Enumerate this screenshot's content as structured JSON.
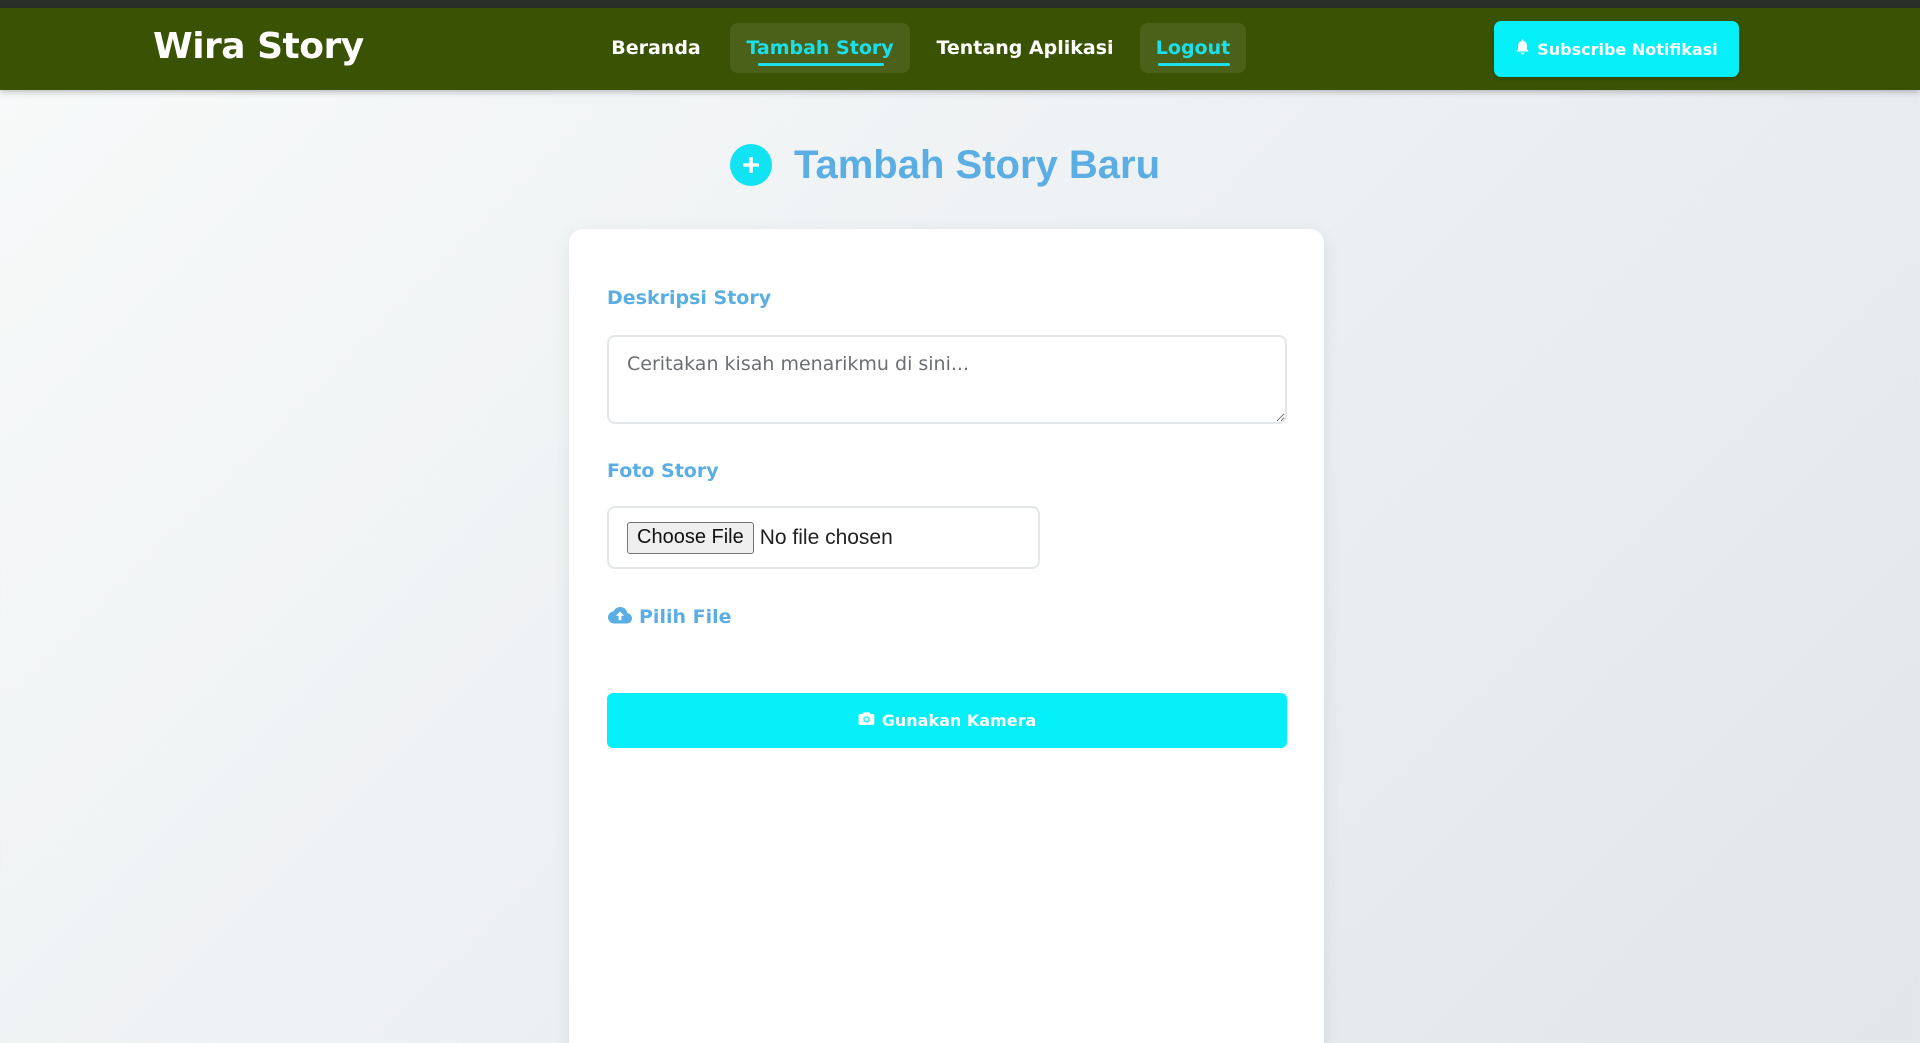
{
  "navbar": {
    "brand": "Wira Story",
    "links": [
      {
        "label": "Beranda",
        "active": false
      },
      {
        "label": "Tambah Story",
        "active": true
      },
      {
        "label": "Tentang Aplikasi",
        "active": false
      },
      {
        "label": "Logout",
        "active": true
      }
    ],
    "subscribe_label": "Subscribe Notifikasi",
    "subscribe_icon": "bell-icon"
  },
  "main": {
    "title": "Tambah Story Baru",
    "title_icon": "plus-circle-icon",
    "form": {
      "description_label": "Deskripsi Story",
      "description_value": "",
      "description_placeholder": "Ceritakan kisah menarikmu di sini...",
      "photo_label": "Foto Story",
      "choose_file_label": "Choose File",
      "file_status": "No file chosen",
      "pick_file_label": "Pilih File",
      "pick_file_icon": "cloud-upload-icon",
      "camera_label": "Gunakan Kamera",
      "camera_icon": "camera-icon"
    }
  },
  "colors": {
    "navbar_bg": "#3a5204",
    "accent_cyan": "#05eff8",
    "active_link": "#1be0ec",
    "label_blue": "#5aaee3"
  }
}
